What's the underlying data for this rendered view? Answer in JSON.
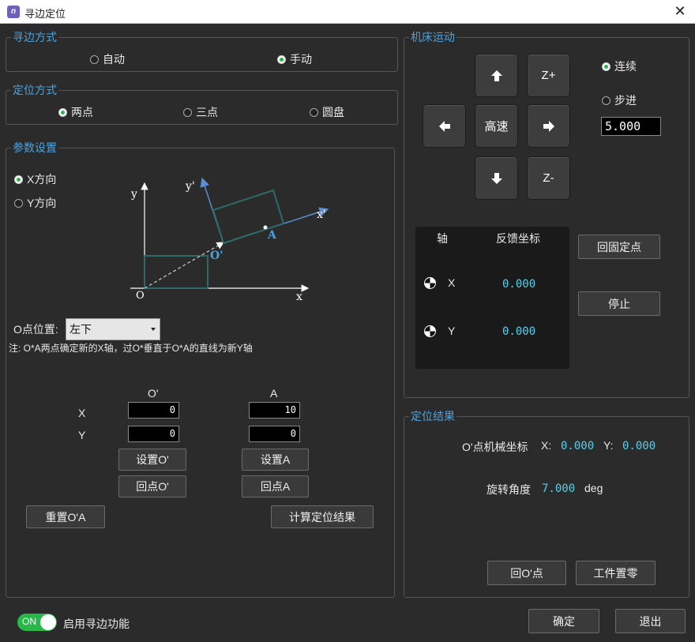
{
  "window": {
    "title": "寻边定位",
    "app_icon": "n-logo-icon"
  },
  "mode": {
    "title": "寻边方式",
    "auto": "自动",
    "manual": "手动",
    "selected": "manual"
  },
  "position": {
    "title": "定位方式",
    "two": "两点",
    "three": "三点",
    "circle": "圆盘",
    "selected": "two"
  },
  "params": {
    "title": "参数设置",
    "x_dir": "X方向",
    "y_dir": "Y方向",
    "selected": "x",
    "diagram": {
      "y": "y",
      "y_prime": "y'",
      "x": "x",
      "x_prime": "x'",
      "origin": "O",
      "o_prime": "O'",
      "a": "A"
    },
    "o_pos_label": "O点位置:",
    "o_pos_value": "左下",
    "note": "注: O*A两点确定新的X轴，过O*垂直于O*A的直线为新Y轴",
    "col_o": "O'",
    "col_a": "A",
    "row_x": "X",
    "row_y": "Y",
    "o_x": "0",
    "o_y": "0",
    "a_x": "10",
    "a_y": "0",
    "set_o": "设置O'",
    "set_a": "设置A",
    "return_o": "回点O'",
    "return_a": "回点A",
    "reset": "重置O'A",
    "calc": "计算定位结果"
  },
  "machine": {
    "title": "机床运动",
    "z_plus": "Z+",
    "z_minus": "Z-",
    "fast": "高速",
    "continuous": "连续",
    "step": "步进",
    "selected": "continuous",
    "step_value": "5.000",
    "col_axis": "轴",
    "col_feedback": "反馈坐标",
    "axis_x": "X",
    "axis_y": "Y",
    "fb_x": "0.000",
    "fb_y": "0.000",
    "return_fixed": "回固定点",
    "stop": "停止"
  },
  "result": {
    "title": "定位结果",
    "coord_label": "O'点机械坐标",
    "x_label": "X:",
    "x_value": "0.000",
    "y_label": "Y:",
    "y_value": "0.000",
    "angle_label": "旋转角度",
    "angle_value": "7.000",
    "angle_unit": "deg",
    "return_o": "回O'点",
    "zero": "工件置零"
  },
  "footer": {
    "toggle": "ON",
    "enable": "启用寻边功能",
    "ok": "确定",
    "exit": "退出"
  },
  "colors": {
    "accent": "#4aa3df",
    "active": "#27b84a",
    "value": "#4fd3f0",
    "diagram": "#2e6b68"
  }
}
